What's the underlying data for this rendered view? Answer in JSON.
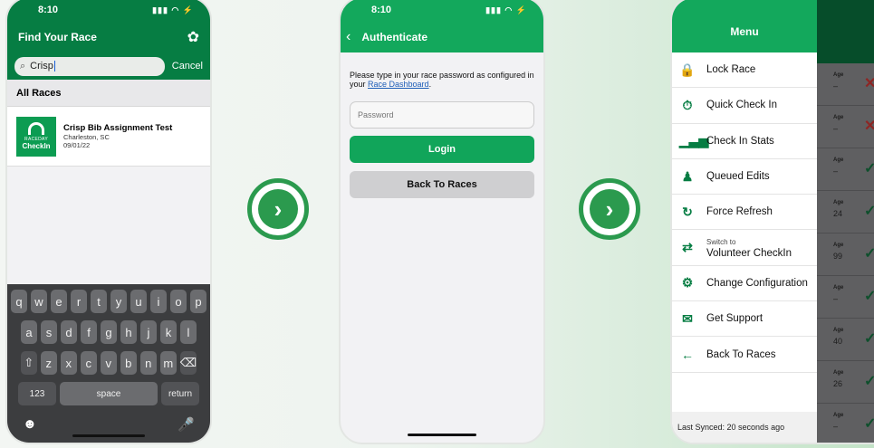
{
  "phone1": {
    "time": "8:10",
    "status_icons": "▮▮▮ ◠ ⚡",
    "title": "Find Your Race",
    "gear_icon": "✿",
    "search": {
      "icon": "⌕",
      "value": "Crisp"
    },
    "cancel_label": "Cancel",
    "section_label": "All Races",
    "race": {
      "logo_top": "RACEDAY",
      "logo_bottom": "CheckIn",
      "name": "Crisp Bib Assignment Test",
      "location": "Charleston, SC",
      "date": "09/01/22"
    },
    "keyboard": {
      "row1": [
        "q",
        "w",
        "e",
        "r",
        "t",
        "y",
        "u",
        "i",
        "o",
        "p"
      ],
      "row2": [
        "a",
        "s",
        "d",
        "f",
        "g",
        "h",
        "j",
        "k",
        "l"
      ],
      "row3": [
        "z",
        "x",
        "c",
        "v",
        "b",
        "n",
        "m"
      ],
      "shift": "⇧",
      "delete": "⌫",
      "numbers": "123",
      "space": "space",
      "return": "return",
      "emoji": "☻",
      "mic": "🎤"
    }
  },
  "arrow_glyph": "›",
  "phone2": {
    "time": "8:10",
    "status_icons": "▮▮▮ ◠ ⚡",
    "back_icon": "‹",
    "title": "Authenticate",
    "prompt_text": "Please type in your race password as configured in your ",
    "prompt_link": "Race Dashboard",
    "prompt_end": ".",
    "password_placeholder": "Password",
    "login_label": "Login",
    "back_label": "Back To Races"
  },
  "phone3": {
    "menu_title": "Menu",
    "items": [
      {
        "icon": "🔒",
        "label": "Lock Race"
      },
      {
        "icon": "⏱",
        "label": "Quick Check In"
      },
      {
        "icon": "▁▃▅",
        "label": "Check In Stats"
      },
      {
        "icon": "♟",
        "label": "Queued Edits"
      },
      {
        "icon": "↻",
        "label": "Force Refresh"
      },
      {
        "icon": "⇄",
        "small": "Switch to",
        "label": "Volunteer CheckIn"
      },
      {
        "icon": "⚙",
        "label": "Change Configuration"
      },
      {
        "icon": "✉",
        "label": "Get Support"
      },
      {
        "icon": "←",
        "label": "Back To Races"
      }
    ],
    "last_synced": "Last Synced: 20 seconds ago",
    "age_label": "Age",
    "rows": [
      {
        "age": "–",
        "mark": "✕",
        "status": "x"
      },
      {
        "age": "–",
        "mark": "✕",
        "status": "x"
      },
      {
        "age": "–",
        "mark": "✓",
        "status": "ok"
      },
      {
        "age": "24",
        "mark": "✓",
        "status": "ok"
      },
      {
        "age": "99",
        "mark": "✓",
        "status": "ok"
      },
      {
        "age": "–",
        "mark": "✓",
        "status": "ok"
      },
      {
        "age": "40",
        "mark": "✓",
        "status": "ok"
      },
      {
        "age": "26",
        "mark": "✓",
        "status": "ok"
      },
      {
        "age": "–",
        "mark": "✓",
        "status": "ok"
      }
    ]
  },
  "colors": {
    "primary_green": "#13a85c",
    "dark_green": "#067d43",
    "arrow_green": "#2b9a4e"
  }
}
